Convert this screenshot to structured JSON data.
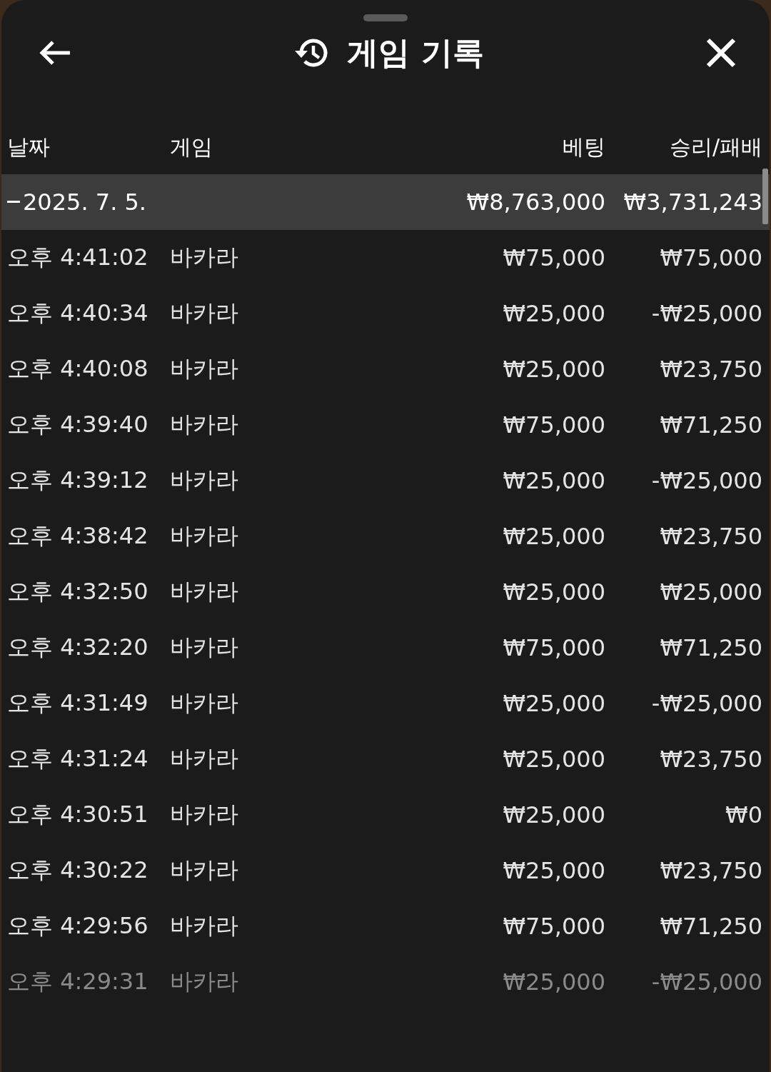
{
  "header": {
    "title": "게임 기록"
  },
  "columns": [
    "날짜",
    "게임",
    "베팅",
    "승리/패배"
  ],
  "group": {
    "expanded": true,
    "date": "2025. 7. 5.",
    "bet": "₩8,763,000",
    "result": "₩3,731,243"
  },
  "rows": [
    {
      "time": "오후 4:41:02",
      "game": "바카라",
      "bet": "₩75,000",
      "result": "₩75,000",
      "dimmed": false
    },
    {
      "time": "오후 4:40:34",
      "game": "바카라",
      "bet": "₩25,000",
      "result": "-₩25,000",
      "dimmed": false
    },
    {
      "time": "오후 4:40:08",
      "game": "바카라",
      "bet": "₩25,000",
      "result": "₩23,750",
      "dimmed": false
    },
    {
      "time": "오후 4:39:40",
      "game": "바카라",
      "bet": "₩75,000",
      "result": "₩71,250",
      "dimmed": false
    },
    {
      "time": "오후 4:39:12",
      "game": "바카라",
      "bet": "₩25,000",
      "result": "-₩25,000",
      "dimmed": false
    },
    {
      "time": "오후 4:38:42",
      "game": "바카라",
      "bet": "₩25,000",
      "result": "₩23,750",
      "dimmed": false
    },
    {
      "time": "오후 4:32:50",
      "game": "바카라",
      "bet": "₩25,000",
      "result": "₩25,000",
      "dimmed": false
    },
    {
      "time": "오후 4:32:20",
      "game": "바카라",
      "bet": "₩75,000",
      "result": "₩71,250",
      "dimmed": false
    },
    {
      "time": "오후 4:31:49",
      "game": "바카라",
      "bet": "₩25,000",
      "result": "-₩25,000",
      "dimmed": false
    },
    {
      "time": "오후 4:31:24",
      "game": "바카라",
      "bet": "₩25,000",
      "result": "₩23,750",
      "dimmed": false
    },
    {
      "time": "오후 4:30:51",
      "game": "바카라",
      "bet": "₩25,000",
      "result": "₩0",
      "dimmed": false
    },
    {
      "time": "오후 4:30:22",
      "game": "바카라",
      "bet": "₩25,000",
      "result": "₩23,750",
      "dimmed": false
    },
    {
      "time": "오후 4:29:56",
      "game": "바카라",
      "bet": "₩75,000",
      "result": "₩71,250",
      "dimmed": false
    },
    {
      "time": "오후 4:29:31",
      "game": "바카라",
      "bet": "₩25,000",
      "result": "-₩25,000",
      "dimmed": true
    }
  ]
}
